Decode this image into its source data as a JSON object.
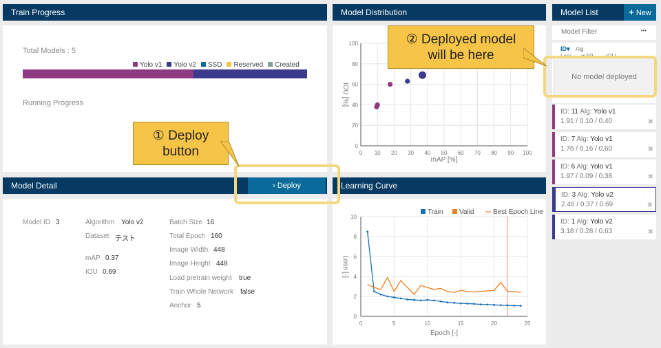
{
  "train_progress": {
    "title": "Train Progress",
    "total_models_label": "Total Models : 5",
    "legend": [
      {
        "label": "Yolo v1",
        "color": "#8e3a80"
      },
      {
        "label": "Yolo v2",
        "color": "#3b3a8c"
      },
      {
        "label": "SSD",
        "color": "#0a6a9a"
      },
      {
        "label": "Reserved",
        "color": "#f2c14a"
      },
      {
        "label": "Created",
        "color": "#8a9a9a"
      }
    ],
    "bar_fractions": {
      "Yolo v1": 0.6,
      "Yolo v2": 0.4
    },
    "running_progress_label": "Running Progress"
  },
  "model_distribution": {
    "title": "Model Distribution",
    "chart_data": {
      "type": "scatter",
      "xlabel": "mAP [%]",
      "ylabel": "IOU [%]",
      "xlim": [
        0,
        100
      ],
      "ylim": [
        0,
        100
      ],
      "xticks": [
        "0",
        "10",
        "20",
        "30",
        "40",
        "50",
        "60",
        "70",
        "80",
        "90",
        "100"
      ],
      "yticks": [
        "0",
        "20",
        "40",
        "60",
        "80",
        "100"
      ],
      "points": [
        {
          "x": 9.5,
          "y": 38,
          "series": "Yolo v1"
        },
        {
          "x": 10,
          "y": 40,
          "series": "Yolo v1"
        },
        {
          "x": 17.6,
          "y": 60,
          "series": "Yolo v1"
        },
        {
          "x": 28,
          "y": 63,
          "series": "Yolo v2"
        },
        {
          "x": 37,
          "y": 69,
          "series": "Yolo v2",
          "selected": true
        }
      ],
      "grid": true
    }
  },
  "model_list": {
    "title": "Model List",
    "new_label": "New",
    "filter_label": "Model Filter",
    "filter_more": "•••",
    "sort": {
      "id": "ID",
      "alg": "Alg",
      "loss": "Loss",
      "map": "mAP",
      "iou": "IOU"
    },
    "empty_deploy": "No model deployed",
    "items": [
      {
        "id": "11",
        "alg": "Yolo v1",
        "loss": "1.91",
        "map": "0.10",
        "iou": "0.40",
        "color": "#8e3a80"
      },
      {
        "id": "7",
        "alg": "Yolo v1",
        "loss": "1.76",
        "map": "0.16",
        "iou": "0.60",
        "color": "#8e3a80"
      },
      {
        "id": "6",
        "alg": "Yolo v1",
        "loss": "1.97",
        "map": "0.09",
        "iou": "0.38",
        "color": "#8e3a80"
      },
      {
        "id": "3",
        "alg": "Yolo v2",
        "loss": "2.46",
        "map": "0.37",
        "iou": "0.69",
        "color": "#3b3a8c"
      },
      {
        "id": "1",
        "alg": "Yolo v2",
        "loss": "3.18",
        "map": "0.28",
        "iou": "0.63",
        "color": "#3b3a8c"
      }
    ],
    "id_prefix": "ID:",
    "alg_prefix": "Alg:",
    "sep": "/"
  },
  "model_detail": {
    "title": "Model Detail",
    "deploy_label": "Deploy",
    "model_id_label": "Model ID",
    "model_id": "3",
    "algorithm_label": "Algorithm",
    "algorithm": "Yolo v2",
    "dataset_label": "Dataset",
    "dataset": "テスト",
    "map_label": "mAP",
    "map": "0.37",
    "iou_label": "IOU",
    "iou": "0.69",
    "batch_size_label": "Batch Size",
    "batch_size": "16",
    "total_epoch_label": "Total Epoch",
    "total_epoch": "160",
    "image_width_label": "Image Width",
    "image_width": "448",
    "image_height_label": "Image Height",
    "image_height": "448",
    "load_pretrain_label": "Load pretrain weight",
    "load_pretrain": "true",
    "train_whole_label": "Train Whole Network",
    "train_whole": "false",
    "anchor_label": "Anchor",
    "anchor": "5"
  },
  "learning_curve": {
    "title": "Learning Curve",
    "chart_data": {
      "type": "line",
      "xlabel": "Epoch [-]",
      "ylabel": "Loss [-]",
      "xlim": [
        0,
        25
      ],
      "ylim": [
        0,
        10
      ],
      "xticks": [
        "0",
        "5",
        "10",
        "15",
        "20",
        "25"
      ],
      "yticks": [
        "0",
        "2",
        "4",
        "6",
        "8",
        "10"
      ],
      "series": [
        {
          "name": "Train",
          "color": "#1a6fb5",
          "x": [
            1,
            2,
            3,
            4,
            5,
            6,
            7,
            8,
            9,
            10,
            11,
            12,
            13,
            14,
            15,
            16,
            17,
            18,
            19,
            20,
            21,
            22,
            23,
            24
          ],
          "values": [
            8.5,
            2.5,
            2.2,
            2.0,
            1.9,
            1.8,
            1.7,
            1.65,
            1.6,
            1.65,
            1.6,
            1.5,
            1.4,
            1.35,
            1.3,
            1.28,
            1.25,
            1.2,
            1.18,
            1.15,
            1.12,
            1.1,
            1.08,
            1.06
          ]
        },
        {
          "name": "Valid",
          "color": "#ef7f1a",
          "x": [
            1,
            2,
            3,
            4,
            5,
            6,
            7,
            8,
            9,
            10,
            11,
            12,
            13,
            14,
            15,
            16,
            17,
            18,
            19,
            20,
            21,
            22,
            23,
            24
          ],
          "values": [
            3.2,
            2.9,
            2.7,
            3.9,
            2.5,
            3.6,
            2.9,
            2.2,
            3.1,
            2.9,
            2.7,
            2.8,
            2.5,
            2.4,
            2.6,
            2.5,
            2.45,
            2.5,
            2.55,
            2.6,
            3.4,
            2.5,
            2.5,
            2.4
          ]
        }
      ],
      "best_epoch_label": "Best Epoch Line",
      "best_epoch": 22,
      "best_epoch_color": "#f08a8a"
    }
  },
  "callouts": {
    "deploy": "① Deploy button",
    "deployed": "② Deployed model will be here"
  }
}
